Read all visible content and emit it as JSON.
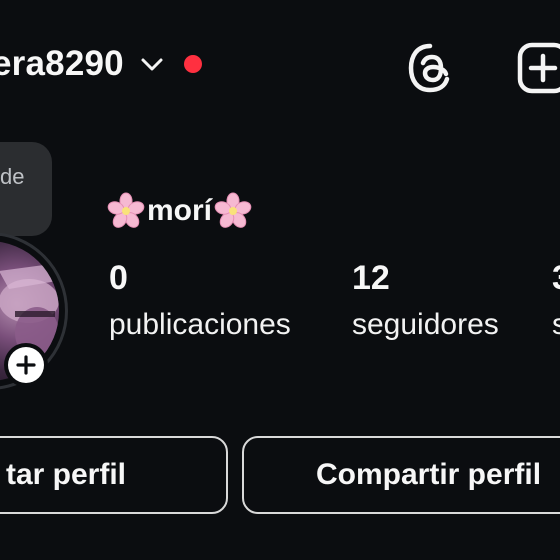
{
  "header": {
    "username": "era8290",
    "account_switcher_icon": "chevron-down-icon",
    "notification_color": "#ff3040",
    "threads_icon": "threads-icon",
    "create_icon": "plus-square-icon"
  },
  "note": {
    "text": "de"
  },
  "profile": {
    "display_name": "morí",
    "name_decoration_icon": "cherry-blossom-icon",
    "add_story_icon": "plus-icon"
  },
  "stats": [
    {
      "value": "0",
      "label": "publicaciones"
    },
    {
      "value": "12",
      "label": "seguidores"
    },
    {
      "value": "3",
      "label": "s"
    }
  ],
  "actions": {
    "edit_label": "tar perfil",
    "share_label": "Compartir perfil"
  },
  "colors": {
    "background": "#0b0d10",
    "text": "#f7f7f7",
    "button_border": "#d9d9d9",
    "note_bubble": "#2b2d30"
  }
}
